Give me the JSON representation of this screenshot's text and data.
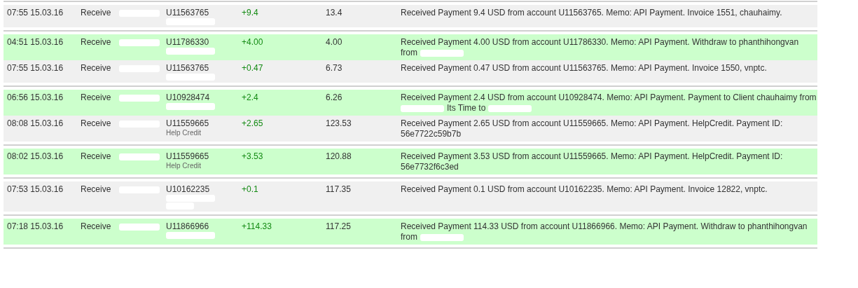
{
  "transactions": [
    {
      "time": "07:55 15.03.16",
      "type": "Receive",
      "account": "U11563765",
      "below": [
        {
          "kind": "redacted"
        }
      ],
      "amount": "+9.4",
      "balance": "13.4",
      "color": "#f0f0f0",
      "ruled": true,
      "memo": "Received Payment 9.4 USD from account U11563765. Memo: API Payment. Invoice 1551, chauhaimy."
    },
    {
      "time": "04:51 15.03.16",
      "type": "Receive",
      "account": "U11786330",
      "below": [
        {
          "kind": "redacted"
        }
      ],
      "amount": "+4.00",
      "balance": "4.00",
      "color": "#ccffcc",
      "ruled": true,
      "memo": "Received Payment 4.00 USD from account U11786330. Memo: API Payment. Withdraw to phanthihongvan",
      "memo_more": [
        {
          "kind": "text",
          "text": "from"
        },
        {
          "kind": "redacted"
        }
      ]
    },
    {
      "time": "07:55 15.03.16",
      "type": "Receive",
      "account": "U11563765",
      "below": [
        {
          "kind": "redacted"
        }
      ],
      "amount": "+0.47",
      "balance": "6.73",
      "color": "#f0f0f0",
      "ruled": false,
      "memo": "Received Payment 0.47 USD from account U11563765. Memo: API Payment. Invoice 1550, vnptc."
    },
    {
      "time": "06:56 15.03.16",
      "type": "Receive",
      "account": "U10928474",
      "below": [
        {
          "kind": "redacted"
        }
      ],
      "amount": "+2.4",
      "balance": "6.26",
      "color": "#ccffcc",
      "ruled": true,
      "memo": "Received Payment 2.4 USD from account U10928474. Memo: API Payment. Payment to Client chauhaimy from",
      "memo_more": [
        {
          "kind": "redacted"
        },
        {
          "kind": "text",
          "text": "Its Time to"
        },
        {
          "kind": "redacted"
        }
      ]
    },
    {
      "time": "08:08 15.03.16",
      "type": "Receive",
      "account": "U11559665",
      "below": [
        {
          "kind": "note",
          "text": "Help Credit"
        }
      ],
      "amount": "+2.65",
      "balance": "123.53",
      "color": "#f0f0f0",
      "ruled": false,
      "memo": "Received Payment 2.65 USD from account U11559665. Memo: API Payment. HelpCredit. Payment ID:",
      "memo_more": [
        {
          "kind": "text",
          "text": "56e7722c59b7b"
        }
      ]
    },
    {
      "time": "08:02 15.03.16",
      "type": "Receive",
      "account": "U11559665",
      "below": [
        {
          "kind": "note",
          "text": "Help Credit"
        }
      ],
      "amount": "+3.53",
      "balance": "120.88",
      "color": "#ccffcc",
      "ruled": true,
      "memo": "Received Payment 3.53 USD from account U11559665. Memo: API Payment. HelpCredit. Payment ID:",
      "memo_more": [
        {
          "kind": "text",
          "text": "56e7732f6c3ed"
        }
      ]
    },
    {
      "time": "07:53 15.03.16",
      "type": "Receive",
      "account": "U10162235",
      "below": [
        {
          "kind": "redacted"
        },
        {
          "kind": "redacted"
        }
      ],
      "amount": "+0.1",
      "balance": "117.35",
      "color": "#f0f0f0",
      "ruled": true,
      "memo": "Received Payment 0.1 USD from account U10162235. Memo: API Payment. Invoice 12822, vnptc."
    },
    {
      "time": "07:18 15.03.16",
      "type": "Receive",
      "account": "U11866966",
      "below": [
        {
          "kind": "redacted"
        }
      ],
      "amount": "+114.33",
      "balance": "117.25",
      "color": "#ccffcc",
      "ruled": true,
      "memo": "Received Payment 114.33 USD from account U11866966. Memo: API Payment. Withdraw to phanthihongvan",
      "memo_more": [
        {
          "kind": "text",
          "text": "from"
        },
        {
          "kind": "redacted"
        }
      ]
    }
  ]
}
